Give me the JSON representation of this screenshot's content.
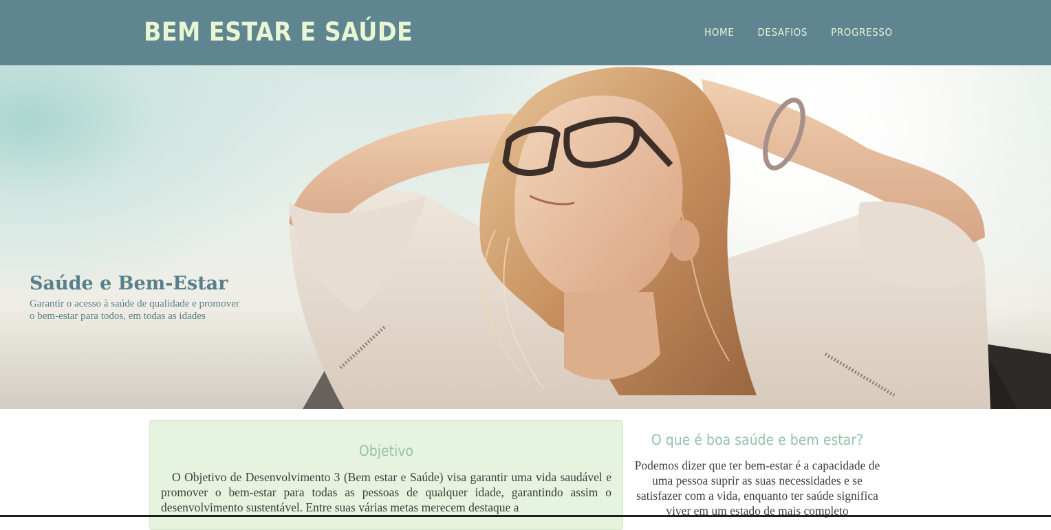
{
  "header": {
    "brand": "BEM ESTAR E SAÚDE",
    "nav": [
      {
        "label": "HOME"
      },
      {
        "label": "DESAFIOS"
      },
      {
        "label": "PROGRESSO"
      }
    ]
  },
  "hero": {
    "title": "Saúde e Bem-Estar",
    "subtitle": "Garantir o acesso à saúde de qualidade e promover o bem-estar para todos, em todas as idades"
  },
  "objective": {
    "title": "Objetivo",
    "text": "O Objetivo de Desenvolvimento 3 (Bem estar e Saúde) visa garantir uma vida saudável e promover o bem-estar para todas as pessoas de qualquer idade, garantindo assim o desenvolvimento sustentável. Entre suas várias metas merecem destaque a"
  },
  "aside": {
    "title": "O que é boa saúde e bem estar?",
    "text": "Podemos dizer que ter bem-estar é a capacidade de uma pessoa suprir as suas necessidades e se satisfazer com a vida, enquanto ter saúde significa viver em um estado de mais completo"
  },
  "colors": {
    "header_bg": "#5e8590",
    "brand_text": "#e9f6d3",
    "accent_green": "#94c3a7",
    "card_bg": "#e6f3de",
    "hero_text": "#56818c"
  }
}
